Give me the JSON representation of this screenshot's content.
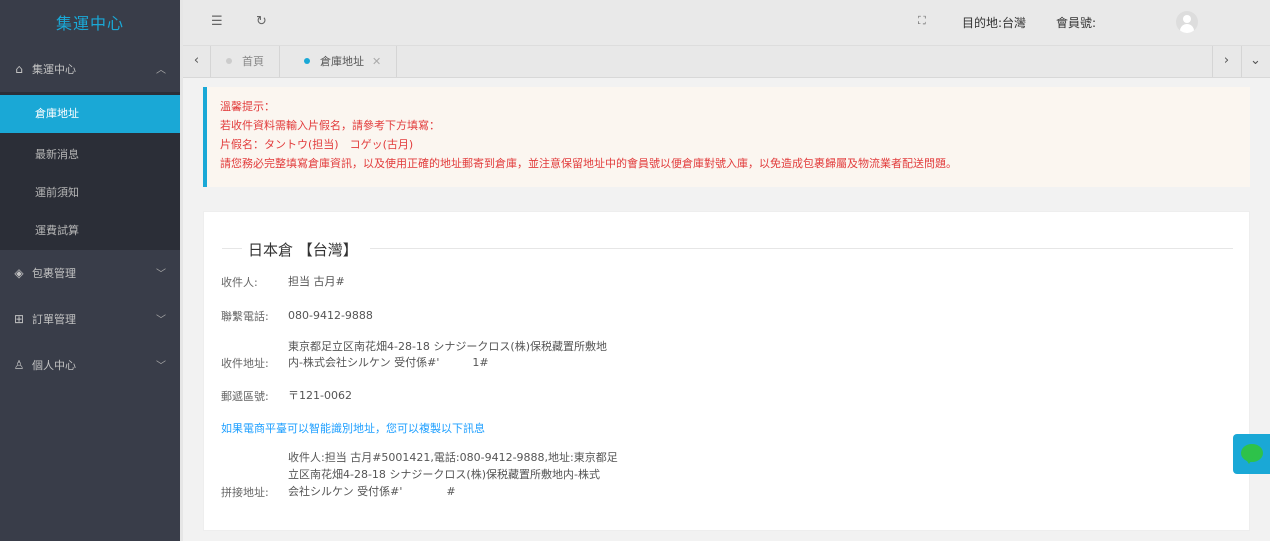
{
  "sidebar": {
    "logo": "集運中心",
    "groups": [
      {
        "label": "集運中心",
        "icon": "home-icon",
        "expanded": true,
        "items": [
          {
            "label": "倉庫地址",
            "active": true
          },
          {
            "label": "最新消息",
            "active": false
          },
          {
            "label": "運前須知",
            "active": false
          },
          {
            "label": "運費試算",
            "active": false
          }
        ]
      },
      {
        "label": "包裹管理",
        "icon": "layers-icon"
      },
      {
        "label": "訂單管理",
        "icon": "apps-icon"
      },
      {
        "label": "個人中心",
        "icon": "user-icon"
      }
    ]
  },
  "header": {
    "destination": "目的地:台灣",
    "member_label": "會員號:"
  },
  "tabs": [
    {
      "label": "首頁",
      "active": false
    },
    {
      "label": "倉庫地址",
      "active": true
    }
  ],
  "notice": {
    "lines": [
      "溫馨提示：",
      "若收件資料需輸入片假名，請參考下方填寫：",
      "片假名：タントウ(担当)　コゲッ(古月)",
      "請您務必完整填寫倉庫資訊，以及使用正確的地址郵寄到倉庫，並注意保留地址中的會員號以便倉庫對號入庫，以免造成包裹歸屬及物流業者配送問題。"
    ]
  },
  "warehouse": {
    "title": "日本倉 【台灣】",
    "recipient_label": "收件人:",
    "recipient_value": "担当 古月#",
    "phone_label": "聯繫電話:",
    "phone_value": "080-9412-9888",
    "address_label": "收件地址:",
    "address_line1": "東京都足立区南花畑4-28-18 シナジークロス(株)保税藏置所敷地",
    "address_line2": "内-株式会社シルケン 受付係#'　　　1#",
    "postal_label": "郵遞區號:",
    "postal_value": "〒121-0062",
    "copy_hint": "如果電商平臺可以智能識別地址，您可以複製以下訊息",
    "combined_label": "拼接地址:",
    "combined_line1": "收件人:担当 古月#5001421,電話:080-9412-9888,地址:東京都足",
    "combined_line2": "立区南花畑4-28-18 シナジークロス(株)保税藏置所敷地内-株式",
    "combined_line3": "会社シルケン 受付係#'　　　　#"
  },
  "colors": {
    "sidebar_bg": "#393d49",
    "accent": "#1aa8d6",
    "notice_text": "#e23c3c",
    "link": "#1e9fff",
    "line_green": "#2ec24a"
  }
}
